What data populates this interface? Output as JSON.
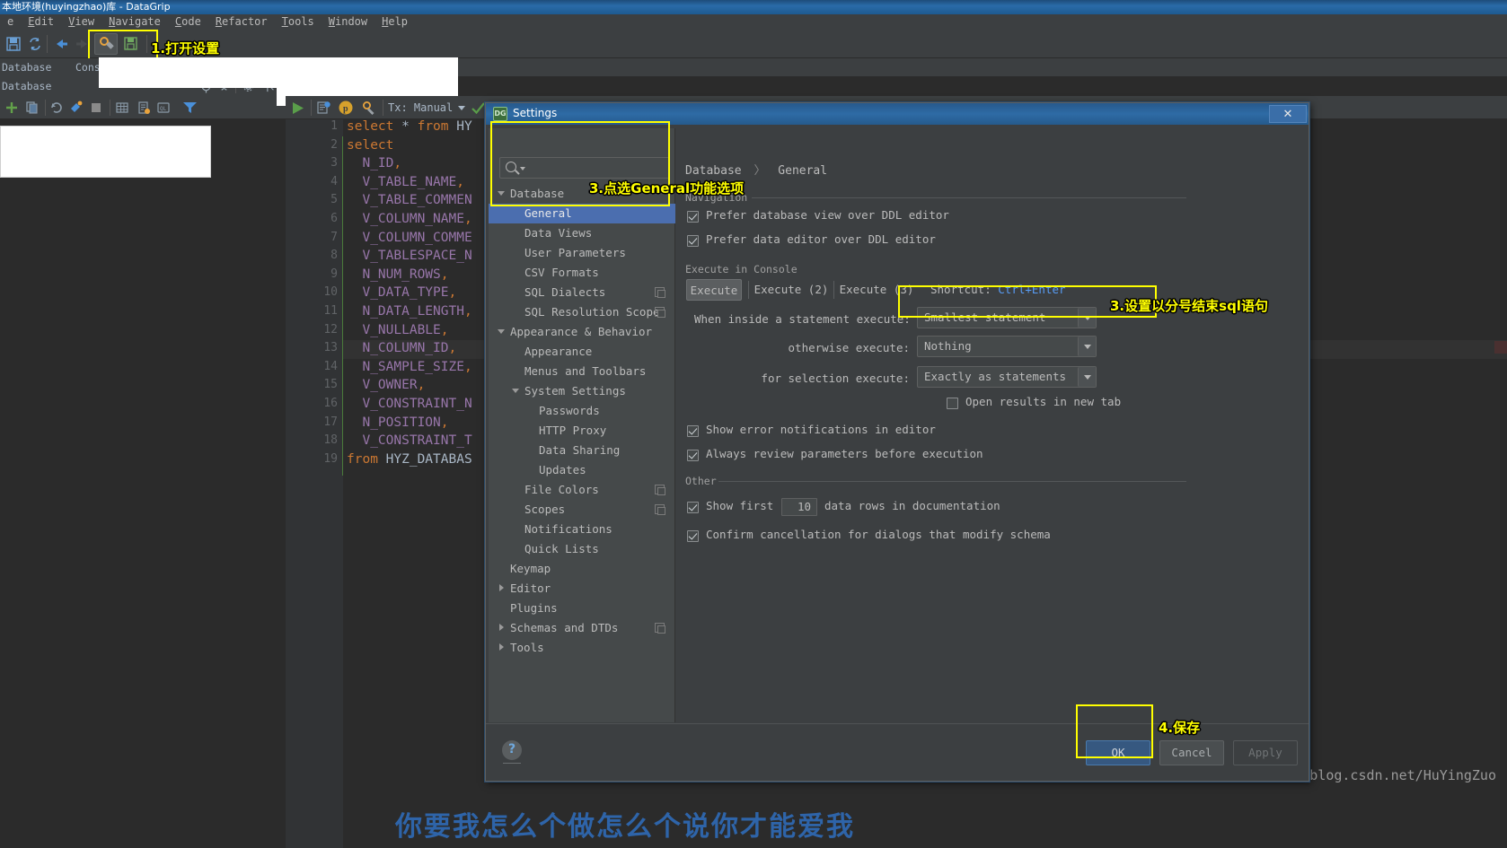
{
  "window": {
    "title": "本地环境(huyingzhao)库 - DataGrip"
  },
  "menubar": {
    "items": [
      "e",
      "Edit",
      "View",
      "Navigate",
      "Code",
      "Refactor",
      "Tools",
      "Window",
      "Help"
    ]
  },
  "toolbar": {
    "icons": [
      "save-icon",
      "sync-icon",
      "back-arrow-icon",
      "forward-arrow-icon",
      "settings-gear-icon",
      "save-all-icon"
    ]
  },
  "annotations": [
    {
      "id": "open-settings",
      "text": "1.打开设置"
    },
    {
      "id": "pick-general",
      "text": "3.点选General功能选项"
    },
    {
      "id": "set-semicolon",
      "text": "3.设置以分号结束sql语句"
    },
    {
      "id": "save",
      "text": "4.保存"
    }
  ],
  "toolwindows": {
    "tabs": [
      "Database",
      "Consoles"
    ],
    "database_panel_title": "Database"
  },
  "editor": {
    "tx_label": "Tx: Manual",
    "lines": [
      {
        "n": 1,
        "tokens": [
          {
            "t": "select",
            "c": "kw"
          },
          {
            "t": " * ",
            "c": "pln"
          },
          {
            "t": "from",
            "c": "kw"
          },
          {
            "t": " HY",
            "c": "pln"
          }
        ]
      },
      {
        "n": 2,
        "tokens": [
          {
            "t": "select",
            "c": "kw"
          }
        ]
      },
      {
        "n": 3,
        "tokens": [
          {
            "t": "  N_ID",
            "c": "col"
          },
          {
            "t": ",",
            "c": "pun"
          }
        ]
      },
      {
        "n": 4,
        "tokens": [
          {
            "t": "  V_TABLE_NAME",
            "c": "col"
          },
          {
            "t": ",",
            "c": "pun"
          }
        ]
      },
      {
        "n": 5,
        "tokens": [
          {
            "t": "  V_TABLE_COMMEN",
            "c": "col"
          }
        ]
      },
      {
        "n": 6,
        "tokens": [
          {
            "t": "  V_COLUMN_NAME",
            "c": "col"
          },
          {
            "t": ",",
            "c": "pun"
          }
        ]
      },
      {
        "n": 7,
        "tokens": [
          {
            "t": "  V_COLUMN_COMME",
            "c": "col"
          }
        ]
      },
      {
        "n": 8,
        "tokens": [
          {
            "t": "  V_TABLESPACE_N",
            "c": "col"
          }
        ]
      },
      {
        "n": 9,
        "tokens": [
          {
            "t": "  N_NUM_ROWS",
            "c": "col"
          },
          {
            "t": ",",
            "c": "pun"
          }
        ]
      },
      {
        "n": 10,
        "tokens": [
          {
            "t": "  V_DATA_TYPE",
            "c": "col"
          },
          {
            "t": ",",
            "c": "pun"
          }
        ]
      },
      {
        "n": 11,
        "tokens": [
          {
            "t": "  N_DATA_LENGTH",
            "c": "col"
          },
          {
            "t": ",",
            "c": "pun"
          }
        ]
      },
      {
        "n": 12,
        "tokens": [
          {
            "t": "  V_NULLABLE",
            "c": "col"
          },
          {
            "t": ",",
            "c": "pun"
          }
        ]
      },
      {
        "n": 13,
        "tokens": [
          {
            "t": "  N_COLUMN_ID",
            "c": "col"
          },
          {
            "t": ",",
            "c": "pun"
          }
        ]
      },
      {
        "n": 14,
        "tokens": [
          {
            "t": "  N_SAMPLE_SIZE",
            "c": "col"
          },
          {
            "t": ",",
            "c": "pun"
          }
        ]
      },
      {
        "n": 15,
        "tokens": [
          {
            "t": "  V_OWNER",
            "c": "col"
          },
          {
            "t": ",",
            "c": "pun"
          }
        ]
      },
      {
        "n": 16,
        "tokens": [
          {
            "t": "  V_CONSTRAINT_N",
            "c": "col"
          }
        ]
      },
      {
        "n": 17,
        "tokens": [
          {
            "t": "  N_POSITION",
            "c": "col"
          },
          {
            "t": ",",
            "c": "pun"
          }
        ]
      },
      {
        "n": 18,
        "tokens": [
          {
            "t": "  V_CONSTRAINT_T",
            "c": "col"
          }
        ]
      },
      {
        "n": 19,
        "tokens": [
          {
            "t": "from",
            "c": "kw"
          },
          {
            "t": " HYZ_DATABAS",
            "c": "pln"
          }
        ]
      }
    ]
  },
  "dialog": {
    "title": "Settings",
    "search_placeholder": "",
    "tree": [
      {
        "label": "Database",
        "indent": 0,
        "arrow": "down",
        "selected": false,
        "copy": false
      },
      {
        "label": "General",
        "indent": 1,
        "arrow": "none",
        "selected": true,
        "copy": false
      },
      {
        "label": "Data Views",
        "indent": 1,
        "arrow": "none",
        "selected": false,
        "copy": false
      },
      {
        "label": "User Parameters",
        "indent": 1,
        "arrow": "none",
        "selected": false,
        "copy": false
      },
      {
        "label": "CSV Formats",
        "indent": 1,
        "arrow": "none",
        "selected": false,
        "copy": false
      },
      {
        "label": "SQL Dialects",
        "indent": 1,
        "arrow": "none",
        "selected": false,
        "copy": true
      },
      {
        "label": "SQL Resolution Scopes",
        "indent": 1,
        "arrow": "none",
        "selected": false,
        "copy": true
      },
      {
        "label": "Appearance & Behavior",
        "indent": 0,
        "arrow": "down",
        "selected": false,
        "copy": false
      },
      {
        "label": "Appearance",
        "indent": 1,
        "arrow": "none",
        "selected": false,
        "copy": false
      },
      {
        "label": "Menus and Toolbars",
        "indent": 1,
        "arrow": "none",
        "selected": false,
        "copy": false
      },
      {
        "label": "System Settings",
        "indent": 1,
        "arrow": "down",
        "selected": false,
        "copy": false
      },
      {
        "label": "Passwords",
        "indent": 2,
        "arrow": "none",
        "selected": false,
        "copy": false
      },
      {
        "label": "HTTP Proxy",
        "indent": 2,
        "arrow": "none",
        "selected": false,
        "copy": false
      },
      {
        "label": "Data Sharing",
        "indent": 2,
        "arrow": "none",
        "selected": false,
        "copy": false
      },
      {
        "label": "Updates",
        "indent": 2,
        "arrow": "none",
        "selected": false,
        "copy": false
      },
      {
        "label": "File Colors",
        "indent": 1,
        "arrow": "none",
        "selected": false,
        "copy": true
      },
      {
        "label": "Scopes",
        "indent": 1,
        "arrow": "none",
        "selected": false,
        "copy": true
      },
      {
        "label": "Notifications",
        "indent": 1,
        "arrow": "none",
        "selected": false,
        "copy": false
      },
      {
        "label": "Quick Lists",
        "indent": 1,
        "arrow": "none",
        "selected": false,
        "copy": false
      },
      {
        "label": "Keymap",
        "indent": 0,
        "arrow": "none",
        "selected": false,
        "copy": false
      },
      {
        "label": "Editor",
        "indent": 0,
        "arrow": "right",
        "selected": false,
        "copy": false
      },
      {
        "label": "Plugins",
        "indent": 0,
        "arrow": "none",
        "selected": false,
        "copy": false
      },
      {
        "label": "Schemas and DTDs",
        "indent": 0,
        "arrow": "right",
        "selected": false,
        "copy": true
      },
      {
        "label": "Tools",
        "indent": 0,
        "arrow": "right",
        "selected": false,
        "copy": false
      }
    ],
    "breadcrumb": {
      "root": "Database",
      "sep": "〉",
      "leaf": "General"
    },
    "groups": {
      "navigation": "Navigation",
      "execute_in_console": "Execute in Console",
      "other": "Other"
    },
    "navigation": {
      "prefer_db_view": {
        "label": "Prefer database view over DDL editor",
        "checked": true
      },
      "prefer_data_editor": {
        "label": "Prefer data editor over DDL editor",
        "checked": true
      }
    },
    "execute_tabs": [
      "Execute",
      "Execute (2)",
      "Execute (3)"
    ],
    "execute_active": "Execute",
    "shortcut_label": "Shortcut:",
    "shortcut_value": "Ctrl+Enter",
    "fields": [
      {
        "label": "When inside a statement execute:",
        "value": "Smallest statement"
      },
      {
        "label": "otherwise execute:",
        "value": "Nothing"
      },
      {
        "label": "for selection execute:",
        "value": "Exactly as statements"
      }
    ],
    "checkboxes": [
      {
        "label": "Open results in new tab",
        "checked": false
      },
      {
        "label": "Show error notifications in editor",
        "checked": true
      },
      {
        "label": "Always review parameters before execution",
        "checked": true
      },
      {
        "label": "Confirm cancellation for dialogs that modify schema",
        "checked": true
      }
    ],
    "show_first_rows": {
      "prefix": "Show first",
      "value": "10",
      "suffix": "data rows in documentation",
      "checked": true
    },
    "footer": {
      "help": "?",
      "ok": "OK",
      "cancel": "Cancel",
      "apply": "Apply"
    }
  },
  "overlay": {
    "bottom_text": "你要我怎么个做怎么个说你才能爱我",
    "watermark": "https://blog.csdn.net/HuYingZuo"
  },
  "colors": {
    "accent": "#4b6eaf",
    "annotation": "#ffff00",
    "keyword": "#cc7832",
    "column": "#9876aa",
    "link": "#589df6"
  }
}
